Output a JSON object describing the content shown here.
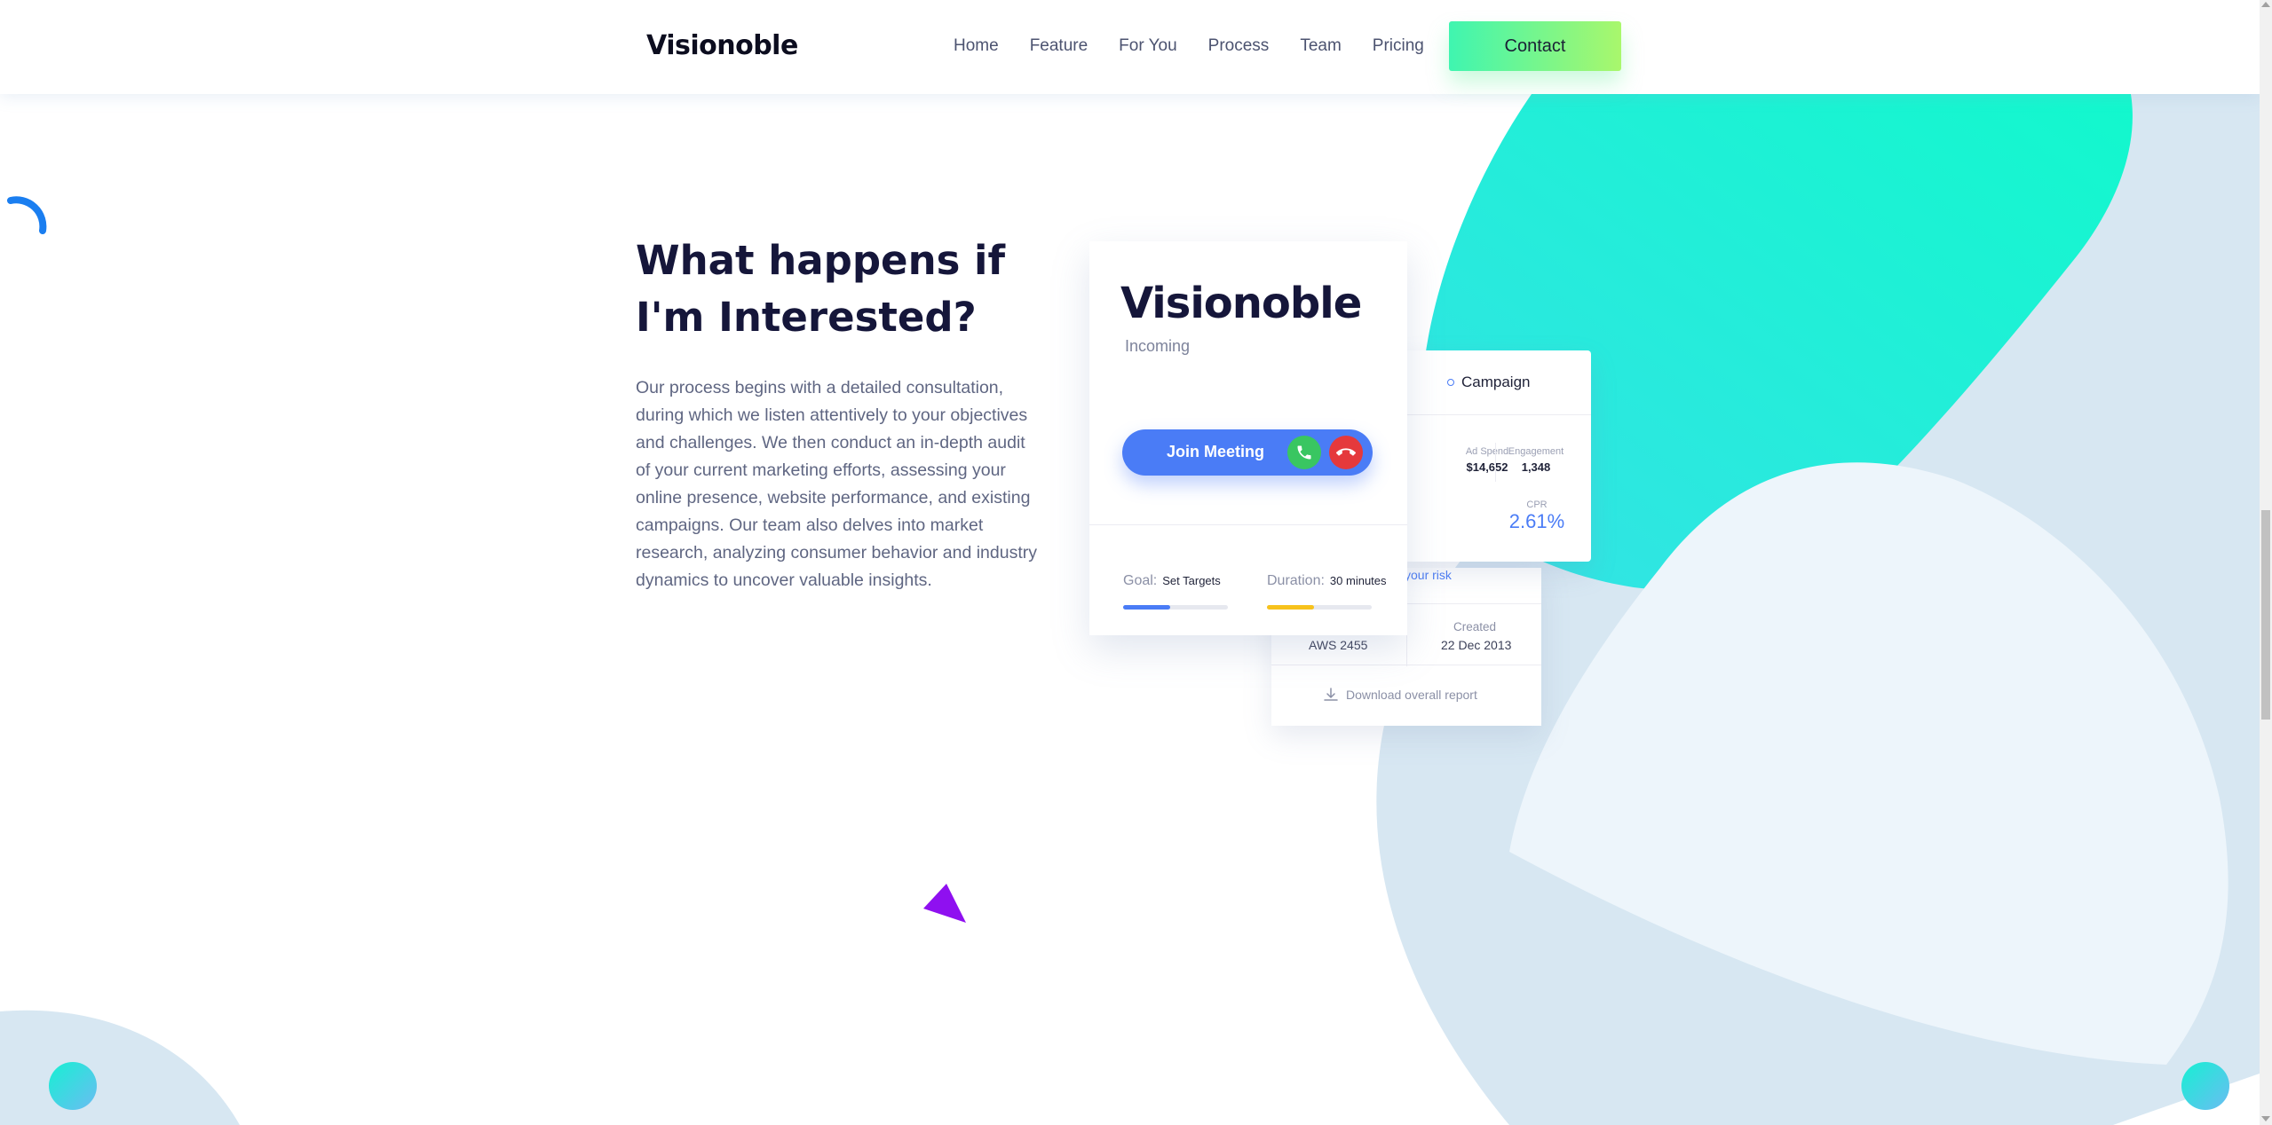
{
  "header": {
    "logo": "Visionoble",
    "nav": [
      "Home",
      "Feature",
      "For You",
      "Process",
      "Team",
      "Pricing"
    ],
    "contact_label": "Contact"
  },
  "section": {
    "heading": "What happens if I'm Interested?",
    "paragraph": "Our process begins with a detailed consultation, during which we listen attentively to your objectives and challenges. We then conduct an in-depth audit of your current marketing efforts, assessing your online presence, website performance, and existing campaigns. Our team also delves into market research, analyzing consumer behavior and industry dynamics to uncover valuable insights."
  },
  "main_card": {
    "title": "Visionoble",
    "subtitle": "Incoming",
    "join_label": "Join Meeting",
    "goal_label": "Goal:",
    "goal_value": "Set Targets",
    "goal_progress": 0.45,
    "duration_label": "Duration:",
    "duration_value": "30 minutes",
    "duration_progress": 0.45
  },
  "campaign_card": {
    "title": "Campaign",
    "ad_spend_label": "Ad Spend",
    "ad_spend_value": "$14,652",
    "engagement_label": "Engagement",
    "engagement_value": "1,348",
    "cpr_label": "CPR",
    "cpr_value": "2.61%"
  },
  "report_card": {
    "risk_text": "your risk",
    "id_value": "AWS 2455",
    "created_label": "Created",
    "created_value": "22 Dec 2013",
    "download_label": "Download overall report"
  },
  "colors": {
    "accent_blue": "#4a7cf6",
    "teal": "#1ff5d0",
    "contact_gradient_start": "#3ff5b0",
    "contact_gradient_end": "#a9f76c",
    "call_green": "#39c661",
    "call_red": "#e5393c",
    "progress_yellow": "#f7c21c",
    "triangle_purple": "#8f10f0"
  }
}
